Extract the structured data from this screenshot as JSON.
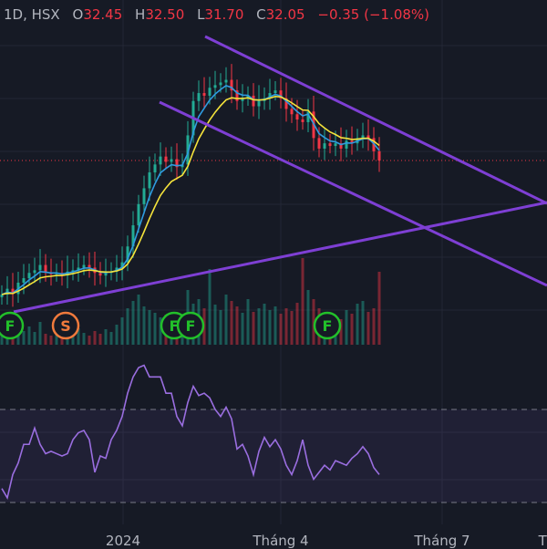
{
  "header": {
    "interval_exchange": "1D, HSX",
    "open_label": "O",
    "open": "32.45",
    "high_label": "H",
    "high": "32.50",
    "low_label": "L",
    "low": "31.70",
    "close_label": "C",
    "close": "32.05",
    "change": "−0.35 (−1.08%)"
  },
  "colors": {
    "background": "#161a25",
    "up": "#22ab94",
    "down": "#f23645",
    "ema_fast": "#2f9be0",
    "ema_slow": "#f5e33b",
    "trendline": "#7e3fd4",
    "rsi": "#9a6ee0",
    "event_F": "#22c02a",
    "event_S": "#f07a3c"
  },
  "chart_data": {
    "type": "candlestick",
    "symbol_interval": "1D, HSX",
    "x_tick_labels": [
      "2024",
      "Tháng 4",
      "Tháng 7",
      "Th"
    ],
    "last_price": 32.05,
    "closes": [
      26.98,
      27.2,
      27.0,
      27.43,
      27.6,
      27.8,
      27.9,
      28.1,
      27.8,
      27.75,
      27.8,
      27.7,
      27.85,
      27.9,
      28.0,
      28.1,
      28.0,
      27.8,
      27.7,
      27.8,
      27.85,
      28.0,
      28.2,
      28.8,
      29.6,
      30.4,
      31.0,
      31.6,
      31.9,
      32.2,
      32.0,
      32.1,
      31.8,
      31.9,
      33.0,
      34.3,
      34.6,
      34.5,
      34.8,
      34.9,
      35.0,
      35.1,
      34.7,
      34.3,
      34.4,
      34.5,
      34.1,
      34.3,
      34.4,
      34.6,
      34.7,
      34.4,
      34.0,
      33.8,
      33.6,
      33.5,
      33.9,
      32.9,
      32.5,
      32.7,
      32.6,
      32.7,
      32.5,
      32.8,
      32.7,
      32.9,
      33.0,
      32.9,
      32.4,
      32.05
    ],
    "volumes": [
      12,
      18,
      10,
      22,
      15,
      20,
      14,
      25,
      12,
      10,
      16,
      9,
      14,
      11,
      18,
      13,
      10,
      15,
      12,
      17,
      14,
      22,
      30,
      40,
      48,
      55,
      42,
      38,
      35,
      30,
      33,
      28,
      36,
      30,
      60,
      45,
      50,
      40,
      83,
      44,
      38,
      55,
      48,
      42,
      35,
      50,
      36,
      40,
      45,
      38,
      42,
      34,
      40,
      37,
      46,
      95,
      60,
      50,
      40,
      30,
      35,
      32,
      28,
      38,
      34,
      45,
      48,
      36,
      40,
      80
    ],
    "indicators": [
      {
        "name": "EMA fast",
        "color": "#2f9be0"
      },
      {
        "name": "EMA slow",
        "color": "#f5e33b"
      }
    ],
    "rsi": {
      "values": [
        36,
        32,
        42,
        47,
        55,
        55,
        62,
        55,
        51,
        52,
        51,
        50,
        51,
        57,
        60,
        61,
        57,
        43,
        50,
        49,
        57,
        61,
        67,
        77,
        84,
        88,
        89,
        84,
        84,
        84,
        77,
        77,
        67,
        63,
        73,
        80,
        76,
        77,
        75,
        70,
        67,
        71,
        66,
        53,
        55,
        50,
        42,
        52,
        58,
        54,
        57,
        53,
        46,
        42,
        48,
        57,
        46,
        40,
        43,
        46,
        44,
        48,
        47,
        46,
        49,
        51,
        54,
        51,
        45,
        42
      ],
      "upper_band": 70,
      "lower_band": 30
    },
    "events": [
      {
        "label": "F",
        "type": "F",
        "index": 1
      },
      {
        "label": "S",
        "type": "S",
        "index": 11
      },
      {
        "label": "F",
        "type": "F",
        "index": 31
      },
      {
        "label": "F",
        "type": "F",
        "index": 34
      },
      {
        "label": "F",
        "type": "F",
        "index": 59
      }
    ]
  }
}
